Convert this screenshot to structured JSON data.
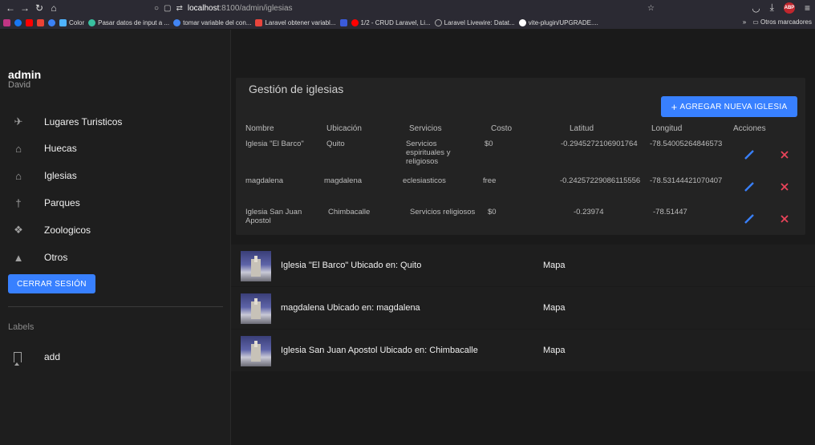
{
  "browser": {
    "url_host": "localhost",
    "url_rest": ":8100/admin/iglesias",
    "bookmarks": [
      {
        "label": "Color",
        "color": "#4fb3ff"
      },
      {
        "label": "Pasar datos de input a ...",
        "color": "#39c0a0"
      },
      {
        "label": "tomar variable del con...",
        "color": "#4285f4"
      },
      {
        "label": "Laravel obtener variabl...",
        "color": "#e9453c"
      },
      {
        "label": "1/2 - CRUD Laravel, Li...",
        "color": "#ff0000"
      },
      {
        "label": "Laravel Livewire: Datat...",
        "color": "#9a9a9a"
      },
      {
        "label": "vite-plugin/UPGRADE....",
        "color": "#ffffff"
      }
    ],
    "other_bookmarks": "Otros marcadores"
  },
  "sidebar": {
    "title": "admin",
    "subtitle": "David",
    "items": [
      {
        "label": "Lugares Turisticos",
        "icon": "airplane-icon"
      },
      {
        "label": "Huecas",
        "icon": "home-icon"
      },
      {
        "label": "Iglesias",
        "icon": "home-icon"
      },
      {
        "label": "Parques",
        "icon": "pin-icon"
      },
      {
        "label": "Zoologicos",
        "icon": "paw-icon"
      },
      {
        "label": "Otros",
        "icon": "warning-icon"
      }
    ],
    "logout_label": "CERRAR SESIÓN",
    "labels_header": "Labels",
    "labels": [
      {
        "label": "add",
        "icon": "bookmark-icon"
      }
    ]
  },
  "main": {
    "title": "Gestión de iglesias",
    "add_button": "AGREGAR NUEVA IGLESIA",
    "columns": [
      "Nombre",
      "Ubicación",
      "Servicios",
      "Costo",
      "Latitud",
      "Longitud",
      "Acciones"
    ],
    "rows": [
      {
        "nombre": "Iglesia \"El Barco\"",
        "ubicacion": "Quito",
        "servicios": "Servicios espirituales y religiosos",
        "costo": "$0",
        "latitud": "-0.2945272106901764",
        "longitud": "-78.54005264846573"
      },
      {
        "nombre": "magdalena",
        "ubicacion": "magdalena",
        "servicios": "eclesiasticos",
        "costo": "free",
        "latitud": "-0.24257229086115556",
        "longitud": "-78.53144421070407"
      },
      {
        "nombre": "Iglesia San Juan Apostol",
        "ubicacion": "Chimbacalle",
        "servicios": "Servicios religiosos",
        "costo": "$0",
        "latitud": "-0.23974",
        "longitud": "-78.51447"
      }
    ],
    "list": [
      {
        "text": "Iglesia \"El Barco\" Ubicado en: Quito",
        "map": "Mapa"
      },
      {
        "text": "magdalena Ubicado en: magdalena",
        "map": "Mapa"
      },
      {
        "text": "Iglesia San Juan Apostol Ubicado en: Chimbacalle",
        "map": "Mapa"
      }
    ]
  },
  "colors": {
    "accent": "#3880ff",
    "delete": "#eb445a",
    "edit": "#3880ff"
  }
}
